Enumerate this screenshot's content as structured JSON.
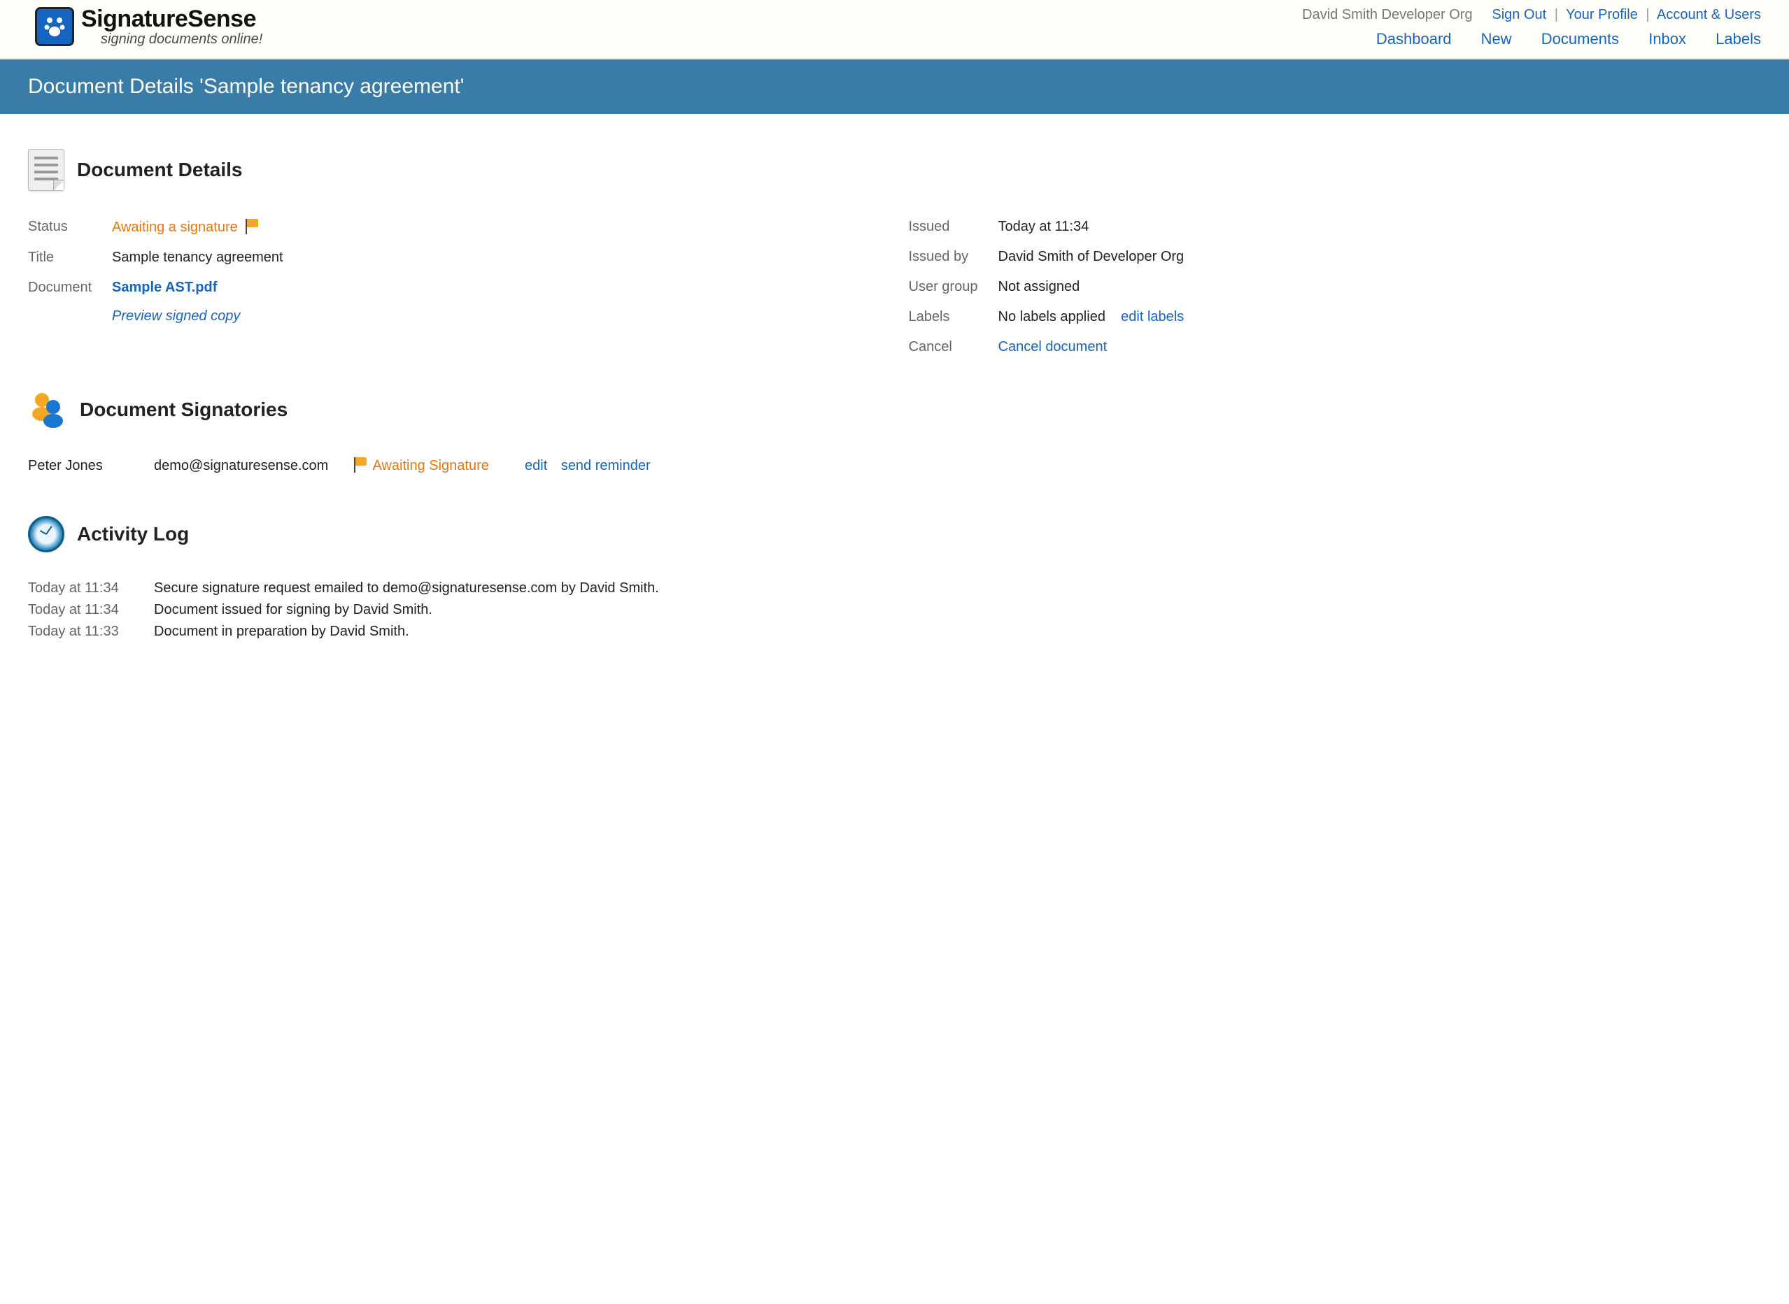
{
  "header": {
    "brand": "SignatureSense",
    "tagline": "signing documents online!",
    "org_label": "David Smith Developer Org",
    "links": {
      "sign_out": "Sign Out",
      "your_profile": "Your Profile",
      "account_users": "Account & Users"
    },
    "nav": {
      "dashboard": "Dashboard",
      "new": "New",
      "documents": "Documents",
      "inbox": "Inbox",
      "labels": "Labels"
    }
  },
  "title_bar": "Document Details  'Sample tenancy agreement'",
  "sections": {
    "details_heading": "Document Details",
    "signatories_heading": "Document Signatories",
    "activity_heading": "Activity Log"
  },
  "details": {
    "status_label": "Status",
    "status_value": "Awaiting a signature",
    "title_label": "Title",
    "title_value": "Sample tenancy agreement",
    "document_label": "Document",
    "document_filename": "Sample AST.pdf",
    "preview_link": "Preview signed copy",
    "issued_label": "Issued",
    "issued_value": "Today at 11:34",
    "issued_by_label": "Issued by",
    "issued_by_value": "David Smith of Developer Org",
    "user_group_label": "User group",
    "user_group_value": "Not assigned",
    "labels_label": "Labels",
    "labels_value": "No labels applied",
    "edit_labels_link": "edit labels",
    "cancel_label": "Cancel",
    "cancel_link": "Cancel document"
  },
  "signatories": [
    {
      "name": "Peter Jones",
      "email": "demo@signaturesense.com",
      "status": "Awaiting Signature",
      "edit": "edit",
      "send_reminder": "send reminder"
    }
  ],
  "activity": [
    {
      "time": "Today at 11:34",
      "text": "Secure signature request emailed to demo@signaturesense.com by David Smith."
    },
    {
      "time": "Today at 11:34",
      "text": "Document issued for signing by David Smith."
    },
    {
      "time": "Today at 11:33",
      "text": "Document in preparation by David Smith."
    }
  ]
}
